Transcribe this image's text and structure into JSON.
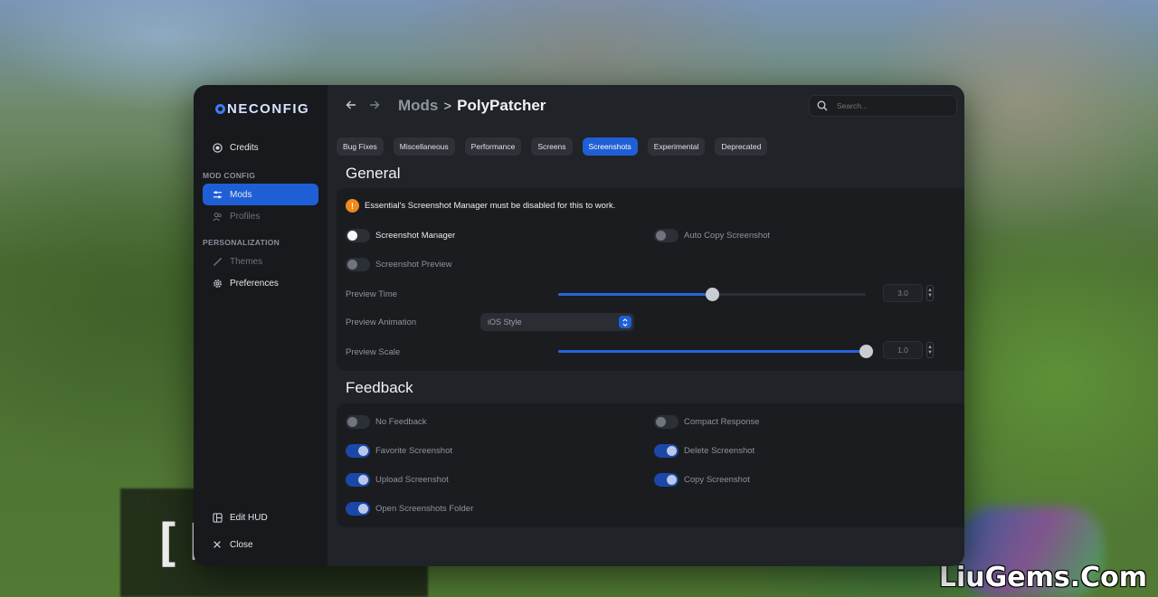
{
  "app": {
    "logo": "NECONFIG",
    "watermark": "LiuGems.Com",
    "background_sign": "[F sin"
  },
  "sidebar": {
    "credits": "Credits",
    "section_mod_config": "MOD CONFIG",
    "mods": "Mods",
    "profiles": "Profiles",
    "section_personalization": "PERSONALIZATION",
    "themes": "Themes",
    "preferences": "Preferences",
    "edit_hud": "Edit HUD",
    "close": "Close"
  },
  "header": {
    "back_icon": "arrow-left-icon",
    "forward_icon": "arrow-right-icon",
    "breadcrumb_parent": "Mods",
    "breadcrumb_separator": ">",
    "breadcrumb_current": "PolyPatcher",
    "search_placeholder": "Search..."
  },
  "tabs": [
    {
      "label": "Bug Fixes",
      "active": false
    },
    {
      "label": "Miscellaneous",
      "active": false
    },
    {
      "label": "Performance",
      "active": false
    },
    {
      "label": "Screens",
      "active": false
    },
    {
      "label": "Screenshots",
      "active": true
    },
    {
      "label": "Experimental",
      "active": false
    },
    {
      "label": "Deprecated",
      "active": false
    }
  ],
  "general": {
    "title": "General",
    "warning": "Essential's Screenshot Manager must be disabled for this to work.",
    "screenshot_manager": {
      "label": "Screenshot Manager",
      "enabled": false
    },
    "auto_copy": {
      "label": "Auto Copy Screenshot",
      "enabled": false
    },
    "screenshot_preview": {
      "label": "Screenshot Preview",
      "enabled": false
    },
    "preview_time": {
      "label": "Preview Time",
      "value": "3.0",
      "fraction": 0.5
    },
    "preview_animation": {
      "label": "Preview Animation",
      "value": "iOS Style"
    },
    "preview_scale": {
      "label": "Preview Scale",
      "value": "1.0",
      "fraction": 1.0
    }
  },
  "feedback": {
    "title": "Feedback",
    "items": {
      "no_feedback": {
        "label": "No Feedback",
        "enabled": false
      },
      "compact_response": {
        "label": "Compact Response",
        "enabled": false
      },
      "favorite_screenshot": {
        "label": "Favorite Screenshot",
        "enabled": true
      },
      "delete_screenshot": {
        "label": "Delete Screenshot",
        "enabled": true
      },
      "upload_screenshot": {
        "label": "Upload Screenshot",
        "enabled": true
      },
      "copy_screenshot": {
        "label": "Copy Screenshot",
        "enabled": true
      },
      "open_folder": {
        "label": "Open Screenshots Folder",
        "enabled": true
      }
    }
  },
  "colors": {
    "accent": "#1f5fd6",
    "warning": "#f08a1c",
    "panel": "#202328",
    "sidebar": "#17191d"
  }
}
